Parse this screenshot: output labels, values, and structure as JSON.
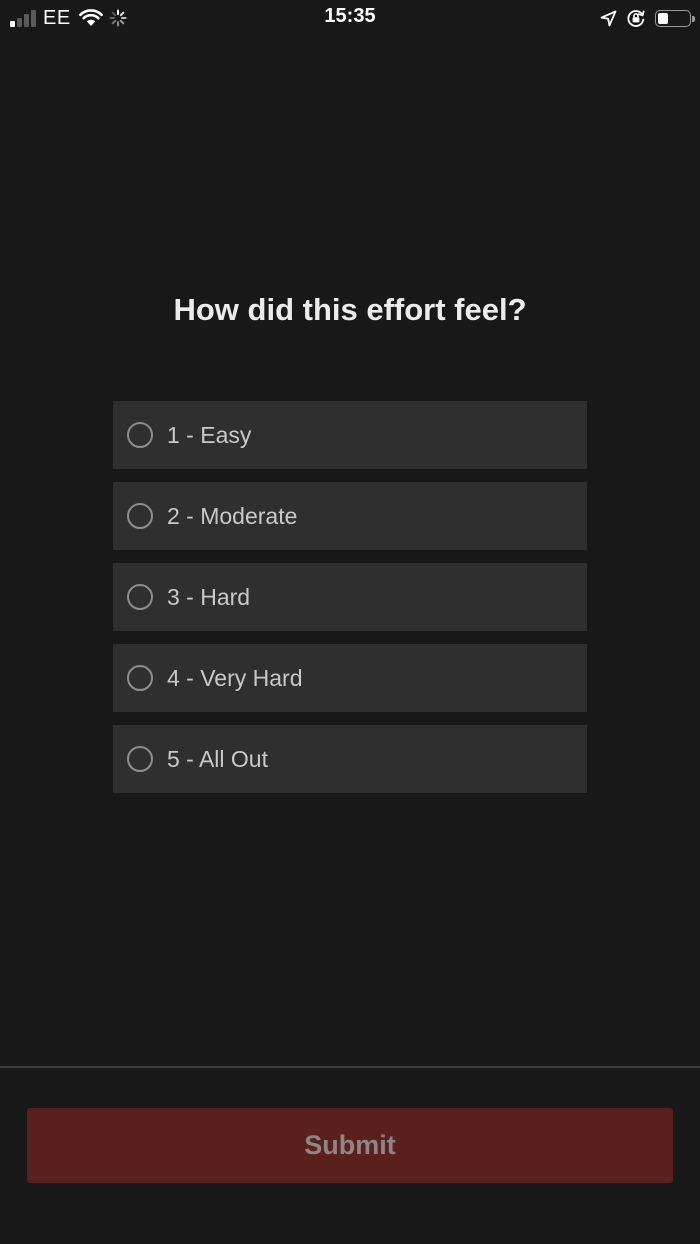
{
  "status_bar": {
    "carrier": "EE",
    "time": "15:35",
    "signal_bars_active": 1,
    "battery_level": 0.35
  },
  "question": "How did this effort feel?",
  "options": [
    {
      "label": "1 - Easy",
      "selected": false
    },
    {
      "label": "2 - Moderate",
      "selected": false
    },
    {
      "label": "3 - Hard",
      "selected": false
    },
    {
      "label": "4 - Very Hard",
      "selected": false
    },
    {
      "label": "5 - All Out",
      "selected": false
    }
  ],
  "submit_label": "Submit",
  "colors": {
    "background": "#181818",
    "option_background": "#2f2f2f",
    "submit_background": "#5a201d",
    "submit_text": "#8d8684"
  }
}
